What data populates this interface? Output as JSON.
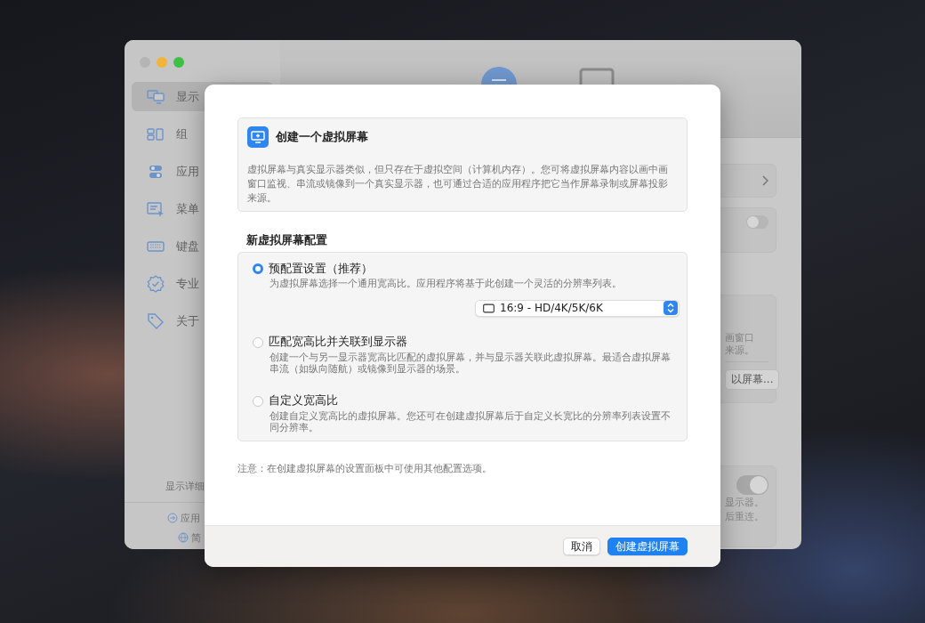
{
  "sidebar": {
    "items": [
      {
        "label": "显示",
        "selected": true
      },
      {
        "label": "组",
        "selected": false
      },
      {
        "label": "应用",
        "selected": false
      },
      {
        "label": "菜单",
        "selected": false
      },
      {
        "label": "键盘",
        "selected": false
      },
      {
        "label": "专业",
        "selected": false
      },
      {
        "label": "关于",
        "selected": false
      }
    ],
    "footer_label": "显示详细",
    "footer_links": [
      "应用",
      "简"
    ]
  },
  "right_panel": {
    "cards": [
      {
        "kind": "link"
      },
      {
        "kind": "toggle",
        "on": false
      },
      {
        "kind": "info",
        "lines": [
          "画窗口",
          "来源。"
        ],
        "button": "以屏幕..."
      },
      {
        "kind": "toggle",
        "on": true,
        "lines": [
          "显示器。",
          "后重连。"
        ]
      }
    ]
  },
  "dialog": {
    "title": "创建一个虚拟屏幕",
    "description": "虚拟屏幕与真实显示器类似，但只存在于虚拟空间（计算机内存）。您可将虚拟屏幕内容以画中画窗口监视、串流或镜像到一个真实显示器，也可通过合适的应用程序把它当作屏幕录制或屏幕投影来源。",
    "section_title": "新虚拟屏幕配置",
    "options": [
      {
        "label": "预配置设置（推荐）",
        "description": "为虚拟屏幕选择一个通用宽高比。应用程序将基于此创建一个灵活的分辨率列表。",
        "selected": true,
        "popup": "16:9 - HD/4K/5K/6K"
      },
      {
        "label": "匹配宽高比并关联到显示器",
        "description": "创建一个与另一显示器宽高比匹配的虚拟屏幕，并与显示器关联此虚拟屏幕。最适合虚拟屏幕串流（如纵向随航）或镜像到显示器的场景。",
        "selected": false
      },
      {
        "label": "自定义宽高比",
        "description": "创建自定义宽高比的虚拟屏幕。您还可在创建虚拟屏幕后于自定义长宽比的分辨率列表设置不同分辨率。",
        "selected": false
      }
    ],
    "note": "注意：在创建虚拟屏幕的设置面板中可使用其他配置选项。",
    "buttons": [
      {
        "label": "取消",
        "kind": "secondary"
      },
      {
        "label": "创建虚拟屏幕",
        "kind": "primary"
      }
    ]
  }
}
